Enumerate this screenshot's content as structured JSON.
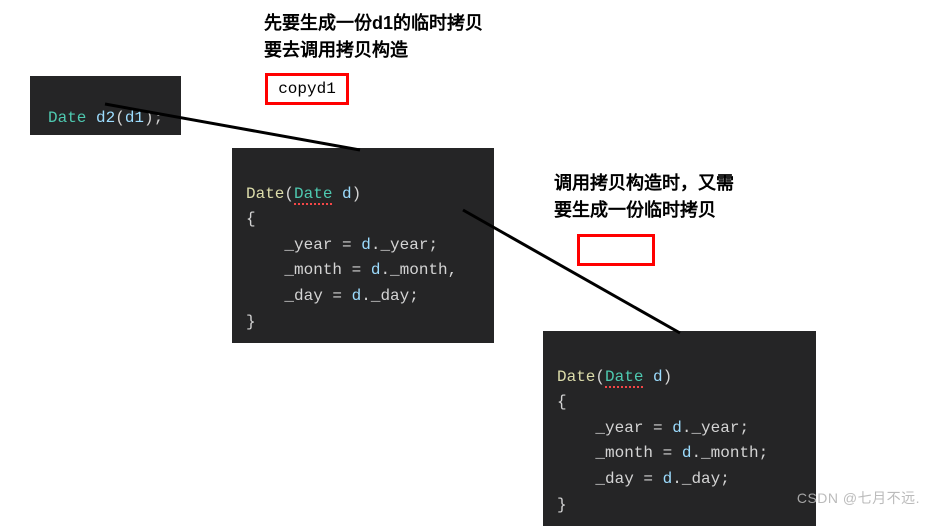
{
  "annotations": {
    "top_text_line1": "先要生成一份d1的临时拷贝",
    "top_text_line2": "要去调用拷贝构造",
    "copy_label": "copyd1",
    "mid_text_line1": "调用拷贝构造时，又需",
    "mid_text_line2": "要生成一份临时拷贝",
    "watermark": "CSDN @七月不远."
  },
  "code_box_1": {
    "type": "Date",
    "var": "d2",
    "arg": "d1",
    "full": "Date d2(d1);"
  },
  "code_box_2": {
    "sig_type": "Date",
    "sig_param_type": "Date",
    "sig_param_name": "d",
    "brace_open": "{",
    "l1a": "_year",
    "l1b": " = ",
    "l1c": "d",
    "l1d": "._year;",
    "l2a": "_month",
    "l2b": " = ",
    "l2c": "d",
    "l2d": "._month,",
    "l3a": "_day",
    "l3b": " = ",
    "l3c": "d",
    "l3d": "._day;",
    "brace_close": "}"
  },
  "code_box_3": {
    "sig_type": "Date",
    "sig_param_type": "Date",
    "sig_param_name": "d",
    "brace_open": "{",
    "l1a": "_year",
    "l1b": " = ",
    "l1c": "d",
    "l1d": "._year;",
    "l2a": "_month",
    "l2b": " = ",
    "l2c": "d",
    "l2d": "._month;",
    "l3a": "_day",
    "l3b": " = ",
    "l3c": "d",
    "l3d": "._day;",
    "brace_close": "}"
  },
  "chart_data": {
    "type": "diagram",
    "title": "Infinite recursion of copy constructor with pass-by-value",
    "nodes": [
      {
        "id": "call",
        "label": "Date d2(d1);"
      },
      {
        "id": "note1",
        "label": "先要生成一份d1的临时拷贝 / 要去调用拷贝构造"
      },
      {
        "id": "copy1",
        "label": "copyd1"
      },
      {
        "id": "ctor1",
        "label": "Date(Date d) { _year = d._year; _month = d._month, _day = d._day; }"
      },
      {
        "id": "note2",
        "label": "调用拷贝构造时，又需要生成一份临时拷贝"
      },
      {
        "id": "copy2",
        "label": ""
      },
      {
        "id": "ctor2",
        "label": "Date(Date d) { _year = d._year; _month = d._month; _day = d._day; }"
      }
    ],
    "edges": [
      {
        "from": "call",
        "to": "ctor1"
      },
      {
        "from": "ctor1",
        "to": "ctor2"
      }
    ]
  }
}
